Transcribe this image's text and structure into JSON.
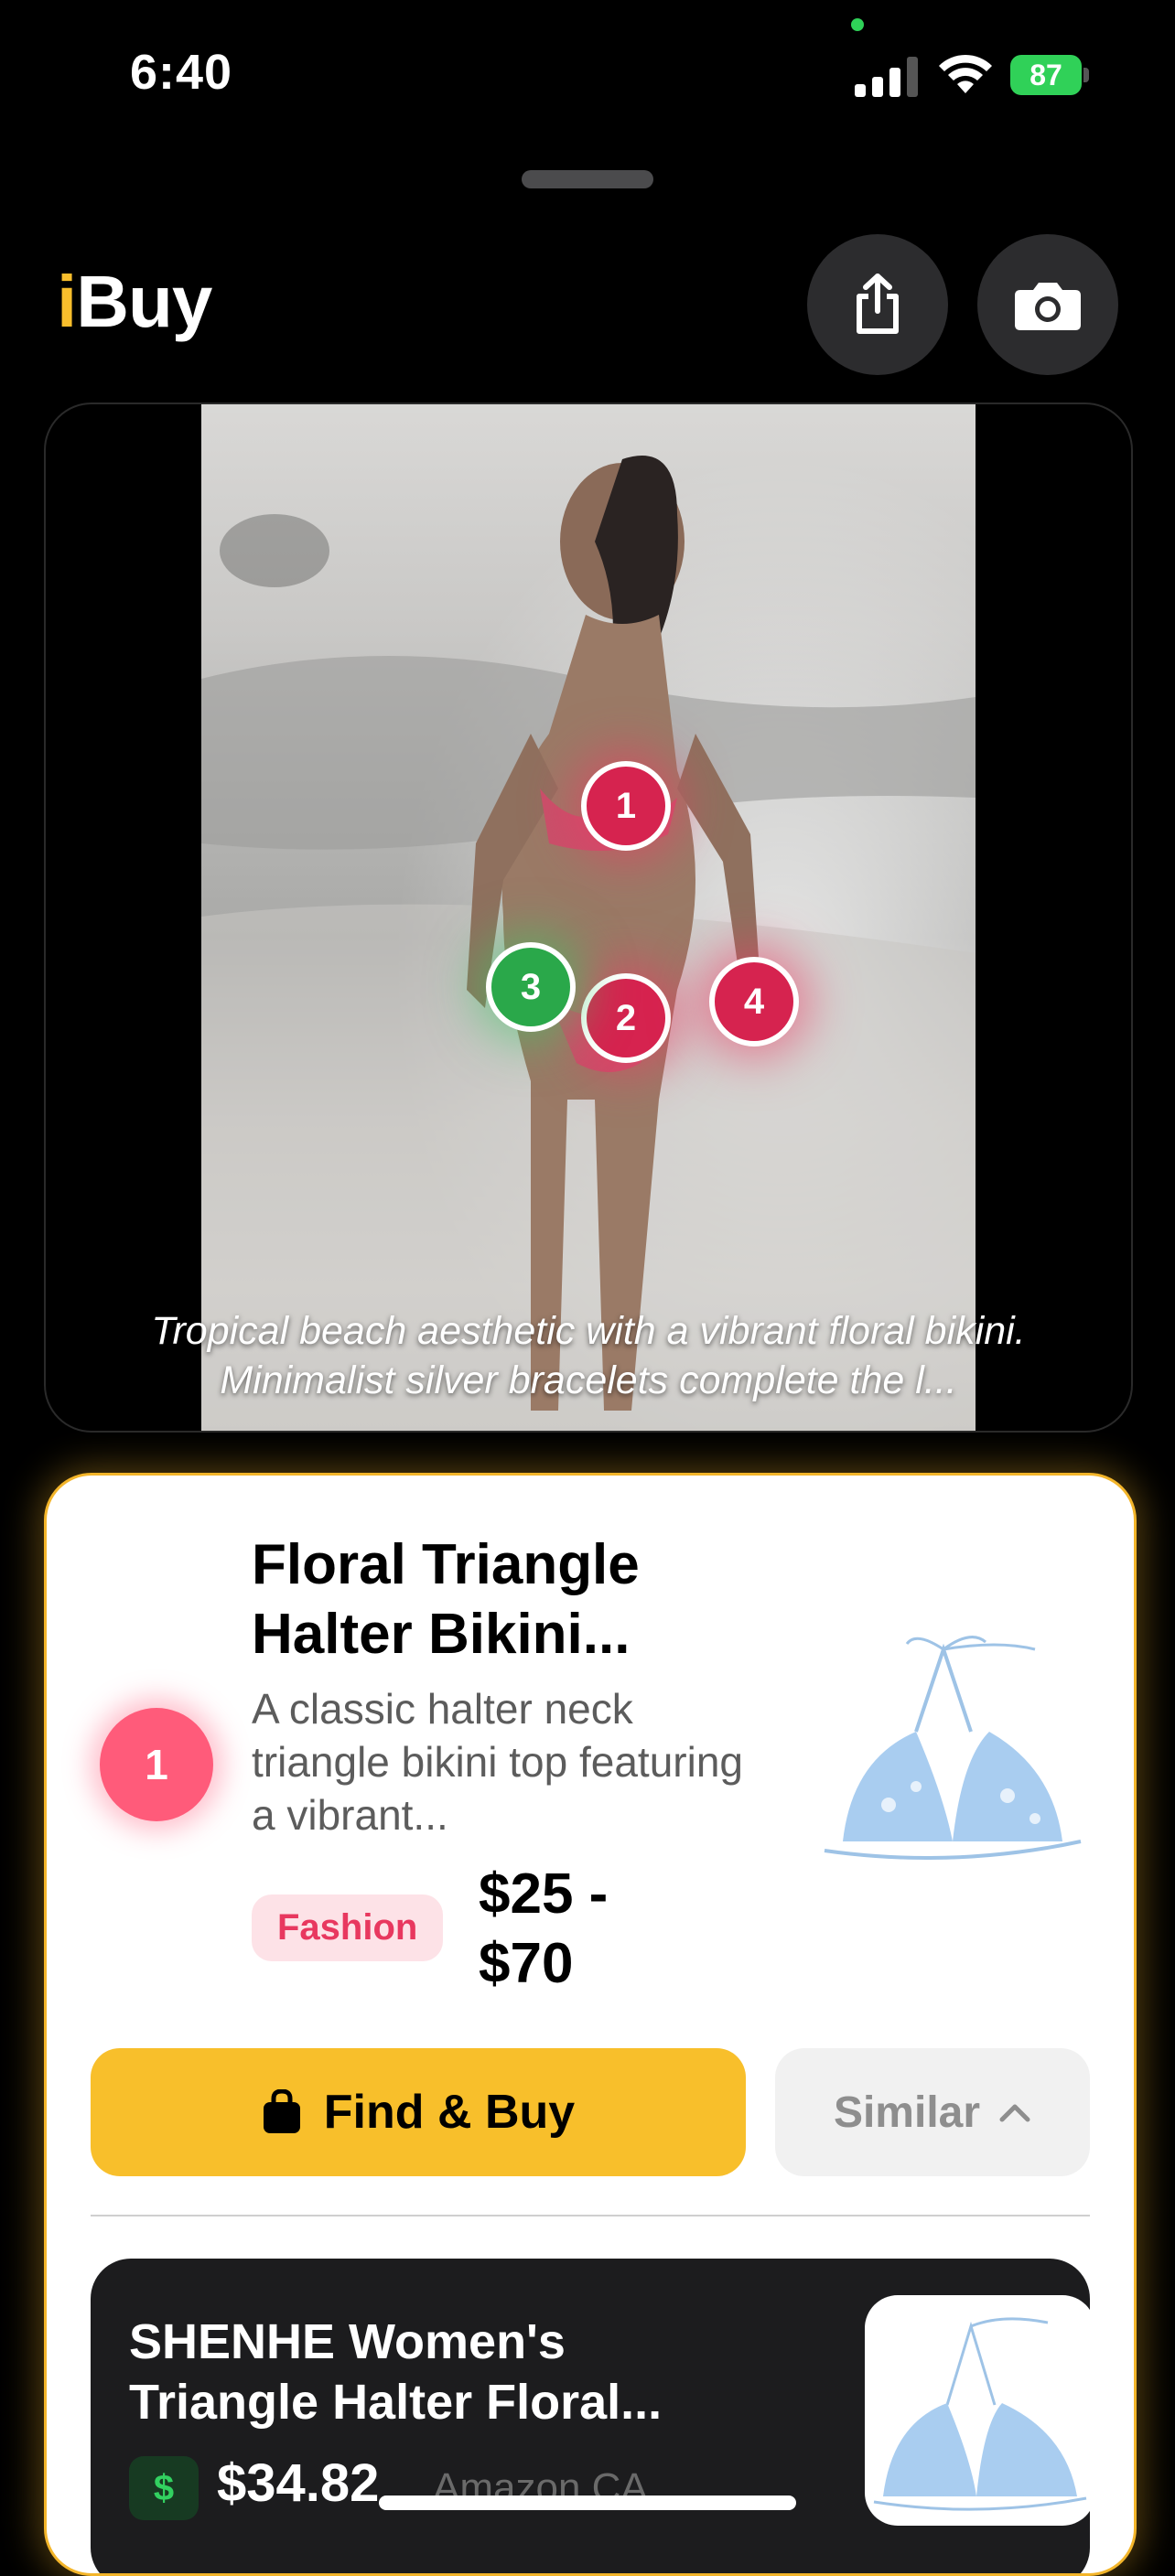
{
  "status_bar": {
    "time": "6:40",
    "battery": "87"
  },
  "header": {
    "logo_i": "i",
    "logo_rest": "Buy",
    "share_icon": "share-icon",
    "camera_icon": "camera-icon"
  },
  "photo": {
    "caption": "Tropical beach aesthetic with a vibrant floral bikini. Minimalist silver bracelets complete the l...",
    "hotspots": [
      "1",
      "2",
      "3",
      "4"
    ]
  },
  "product": {
    "number": "1",
    "title": "Floral Triangle Halter Bikini...",
    "description": "A classic halter neck triangle bikini top featuring a vibrant...",
    "category": "Fashion",
    "price": "$25 - $70",
    "find_label": "Find & Buy",
    "similar_label": "Similar"
  },
  "result": {
    "title": "SHENHE Women's Triangle Halter Floral...",
    "currency_icon": "$",
    "price": "$34.82",
    "store": "Amazon CA"
  },
  "colors": {
    "accent": "#f8bf2b",
    "hotspot_red": "#d6234f",
    "hotspot_green": "#2aa84a",
    "category_pink": "#e8385f"
  }
}
